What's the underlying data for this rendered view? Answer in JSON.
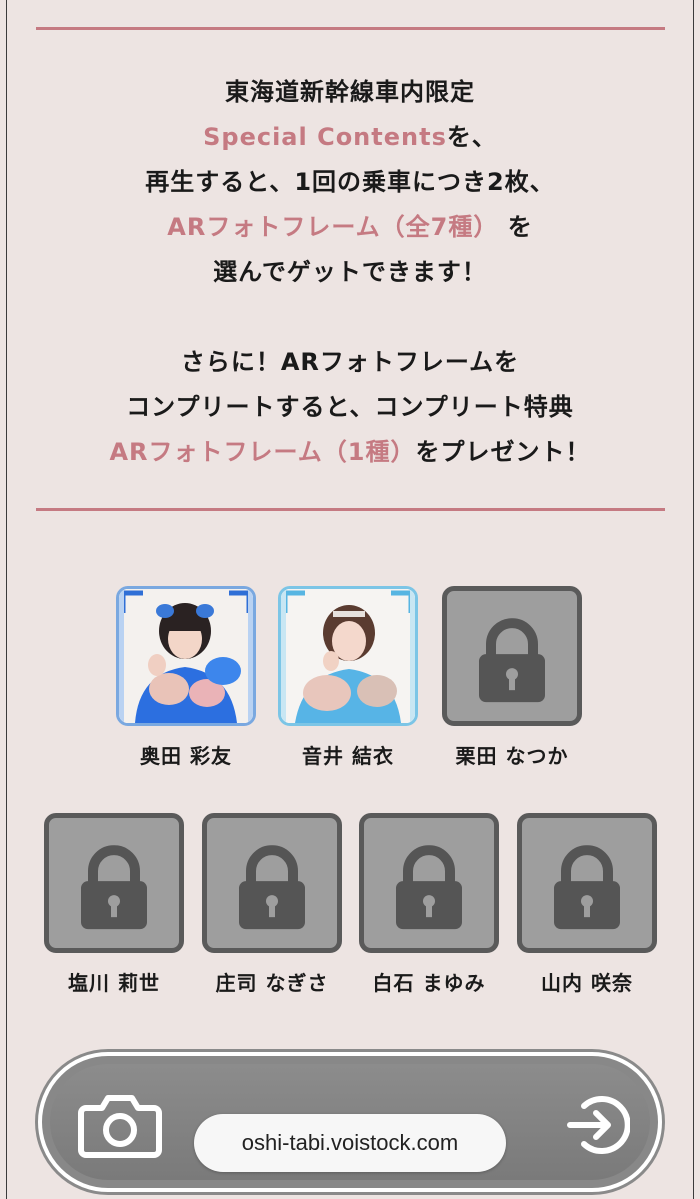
{
  "intro": {
    "line1": "東海道新幹線車内限定",
    "line2_pink": "Special Contents",
    "line2_rest": "を、",
    "line3": "再生すると、1回の乗車につき2枚、",
    "line4_pink": "ARフォトフレーム（全7種）",
    "line4_rest": " を",
    "line5": "選んでゲットできます！",
    "line6": "さらに！ARフォトフレームを",
    "line7": "コンプリートすると、コンプリート特典",
    "line8_pink": "ARフォトフレーム（1種）",
    "line8_rest": "をプレゼント！"
  },
  "members": [
    {
      "name": "奥田 彩友",
      "status": "unlocked"
    },
    {
      "name": "音井 結衣",
      "status": "unlocked"
    },
    {
      "name": "栗田 なつか",
      "status": "locked"
    },
    {
      "name": "塩川 莉世",
      "status": "locked"
    },
    {
      "name": "庄司 なぎさ",
      "status": "locked"
    },
    {
      "name": "白石 まゆみ",
      "status": "locked"
    },
    {
      "name": "山内 咲奈",
      "status": "locked"
    }
  ],
  "browser": {
    "url": "oshi-tabi.voistock.com"
  },
  "icons": {
    "camera": "camera-icon",
    "next": "arrow-into-circle-icon",
    "lock": "lock-icon"
  },
  "colors": {
    "accent_pink": "#c57a82",
    "background": "#ede4e2",
    "locked_tile": "#9e9e9e"
  }
}
